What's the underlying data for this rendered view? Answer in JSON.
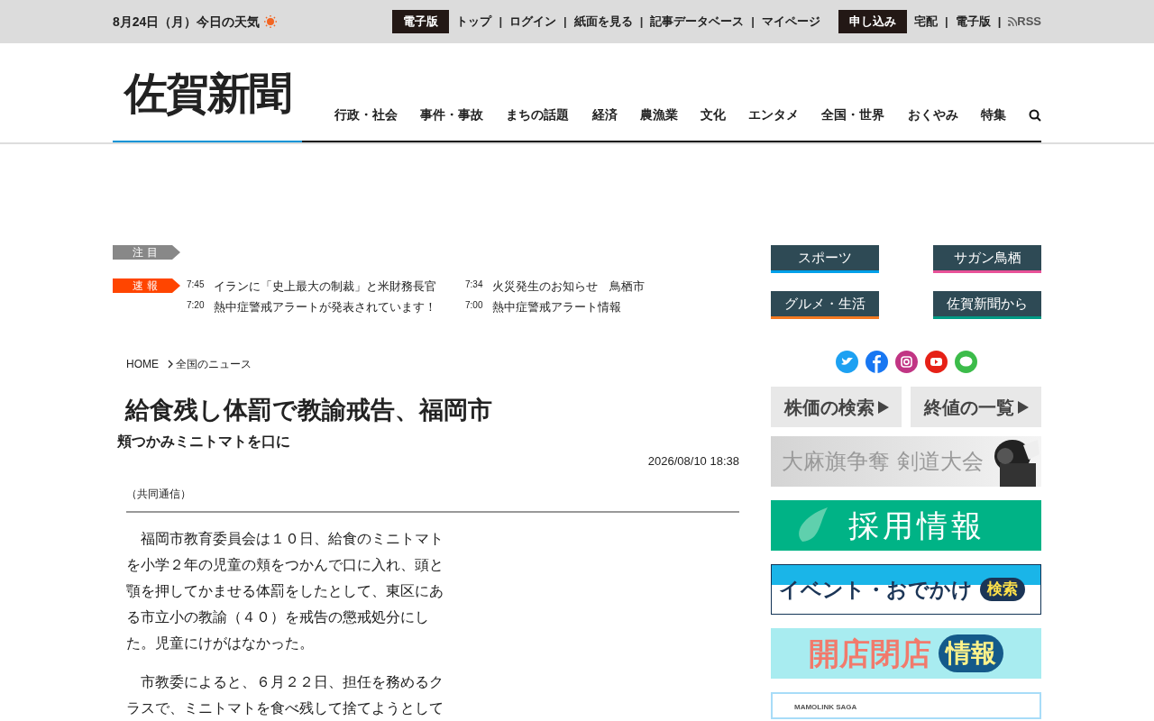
{
  "topbar": {
    "date": "8月24日（月）今日の天気",
    "groups": [
      {
        "label": "電子版",
        "links": [
          "トップ",
          "ログイン",
          "紙面を見る",
          "記事データベース",
          "マイページ"
        ]
      },
      {
        "label": "申し込み",
        "links": [
          "宅配",
          "電子版"
        ]
      }
    ],
    "separator": "|",
    "rss": "RSS"
  },
  "logo": "佐賀新聞",
  "nav": [
    "行政・社会",
    "事件・事故",
    "まちの話題",
    "経済",
    "農漁業",
    "文化",
    "エンタメ",
    "全国・世界",
    "おくやみ",
    "特集"
  ],
  "ticker": {
    "featured_label": "注目",
    "flash_label": "速報",
    "items": [
      {
        "time": "7:45",
        "title": "イランに「史上最大の制裁」と米財務長官"
      },
      {
        "time": "7:34",
        "title": "火災発生のお知らせ　鳥栖市"
      },
      {
        "time": "7:20",
        "title": "熱中症警戒アラートが発表されています！"
      },
      {
        "time": "7:00",
        "title": "熱中症警戒アラート情報"
      }
    ]
  },
  "breadcrumb": [
    "HOME",
    "全国のニュース"
  ],
  "article": {
    "title": "給食残し体罰で教諭戒告、福岡市",
    "subtitle": "頬つかみミニトマトを口に",
    "date": "2026/08/10 18:38",
    "source": "（共同通信）",
    "paragraphs": [
      "　福岡市教育委員会は１０日、給食のミニトマトを小学２年の児童の頬をつかんで口に入れ、頭と顎を押してかませる体罰をしたとして、東区にある市立小の教諭（４０）を戒告の懲戒処分にした。児童にけがはなかった。",
      "　市教委によると、６月２２日、担任を務めるクラスで、ミニトマトを食べ残して捨てようとして"
    ]
  },
  "categories": [
    {
      "label": "スポーツ",
      "color": "#00a0e9"
    },
    {
      "label": "サガン鳥栖",
      "color": "#e85298"
    },
    {
      "label": "グルメ・生活",
      "color": "#f47920"
    },
    {
      "label": "佐賀新聞から",
      "color": "#009b85"
    }
  ],
  "stock_buttons": [
    "株価の検索",
    "終値の一覧"
  ],
  "banners": [
    {
      "kind": "kendo",
      "text": "大麻旗争奪 剣道大会"
    },
    {
      "kind": "jobs",
      "text": "採用情報"
    },
    {
      "kind": "event",
      "text": "イベント・おでかけ",
      "badge": "検索"
    },
    {
      "kind": "shops",
      "text": "開店閉店",
      "badge": "情報"
    },
    {
      "kind": "mamolink",
      "text": "MAMOLINK SAGA"
    }
  ]
}
